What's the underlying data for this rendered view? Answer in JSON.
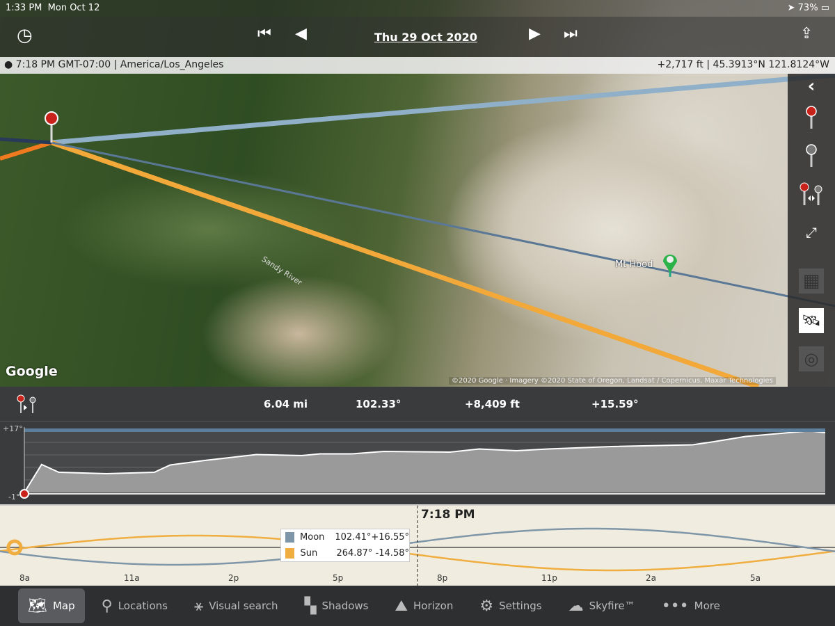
{
  "status": {
    "time": "1:33 PM",
    "date": "Mon Oct 12",
    "battery": "73%"
  },
  "toolbar": {
    "date": "Thu 29 Oct 2020"
  },
  "infobar": {
    "left": "7:18 PM GMT-07:00 | America/Los_Angeles",
    "right": "+2,717 ft | 45.3913°N 121.8124°W"
  },
  "map": {
    "google": "Google",
    "attribution": "©2020 Google · Imagery ©2020 State of Oregon, Landsat / Copernicus, Maxar Technologies",
    "marker_label": "Mt Hood",
    "river_label": "Sandy River"
  },
  "stats": {
    "distance": "6.04 mi",
    "bearing": "102.33°",
    "elevation_diff": "+8,409 ft",
    "altitude_angle": "+15.59°"
  },
  "profile": {
    "y_max_label": "+17°",
    "y_min_label": "-1°",
    "ylim": [
      -1,
      17
    ],
    "points": [
      [
        0,
        -1
      ],
      [
        0.13,
        7.05
      ],
      [
        0.26,
        4.8
      ],
      [
        0.62,
        4.4
      ],
      [
        0.98,
        4.8
      ],
      [
        1.1,
        6.9
      ],
      [
        1.36,
        8.2
      ],
      [
        1.75,
        9.9
      ],
      [
        2.09,
        9.6
      ],
      [
        2.23,
        10.1
      ],
      [
        2.47,
        10.1
      ],
      [
        2.71,
        10.8
      ],
      [
        3.21,
        10.6
      ],
      [
        3.43,
        11.5
      ],
      [
        3.71,
        11
      ],
      [
        3.95,
        11.5
      ],
      [
        4.43,
        12.2
      ],
      [
        5.04,
        12.7
      ],
      [
        5.2,
        13.6
      ],
      [
        5.44,
        15.1
      ],
      [
        5.92,
        16.7
      ],
      [
        6.04,
        16.2
      ]
    ],
    "line_of_sight_deg": 15.59
  },
  "timeline": {
    "current_time": "7:18 PM",
    "ticks": [
      "8a",
      "11a",
      "2p",
      "5p",
      "8p",
      "11p",
      "2a",
      "5a"
    ],
    "legend": [
      {
        "name": "Moon",
        "azimuth": "102.41°",
        "altitude": "+16.55°",
        "color": "#7f95a8"
      },
      {
        "name": "Sun",
        "azimuth": "264.87°",
        "altitude": "-14.58°",
        "color": "#f0ad40"
      }
    ]
  },
  "tabs": [
    {
      "label": "Map",
      "icon": "map-icon",
      "active": true
    },
    {
      "label": "Locations",
      "icon": "search-icon"
    },
    {
      "label": "Visual search",
      "icon": "visual-search-icon"
    },
    {
      "label": "Shadows",
      "icon": "shadows-icon"
    },
    {
      "label": "Horizon",
      "icon": "horizon-icon"
    },
    {
      "label": "Settings",
      "icon": "gear-icon"
    },
    {
      "label": "Skyfire™",
      "icon": "skyfire-icon"
    },
    {
      "label": "More",
      "icon": "more-icon"
    }
  ],
  "colors": {
    "sun": "#f0ad40",
    "moon": "#7f95a8",
    "sun_line": "#f2a93a",
    "moon_line": "#8fb0c8"
  }
}
